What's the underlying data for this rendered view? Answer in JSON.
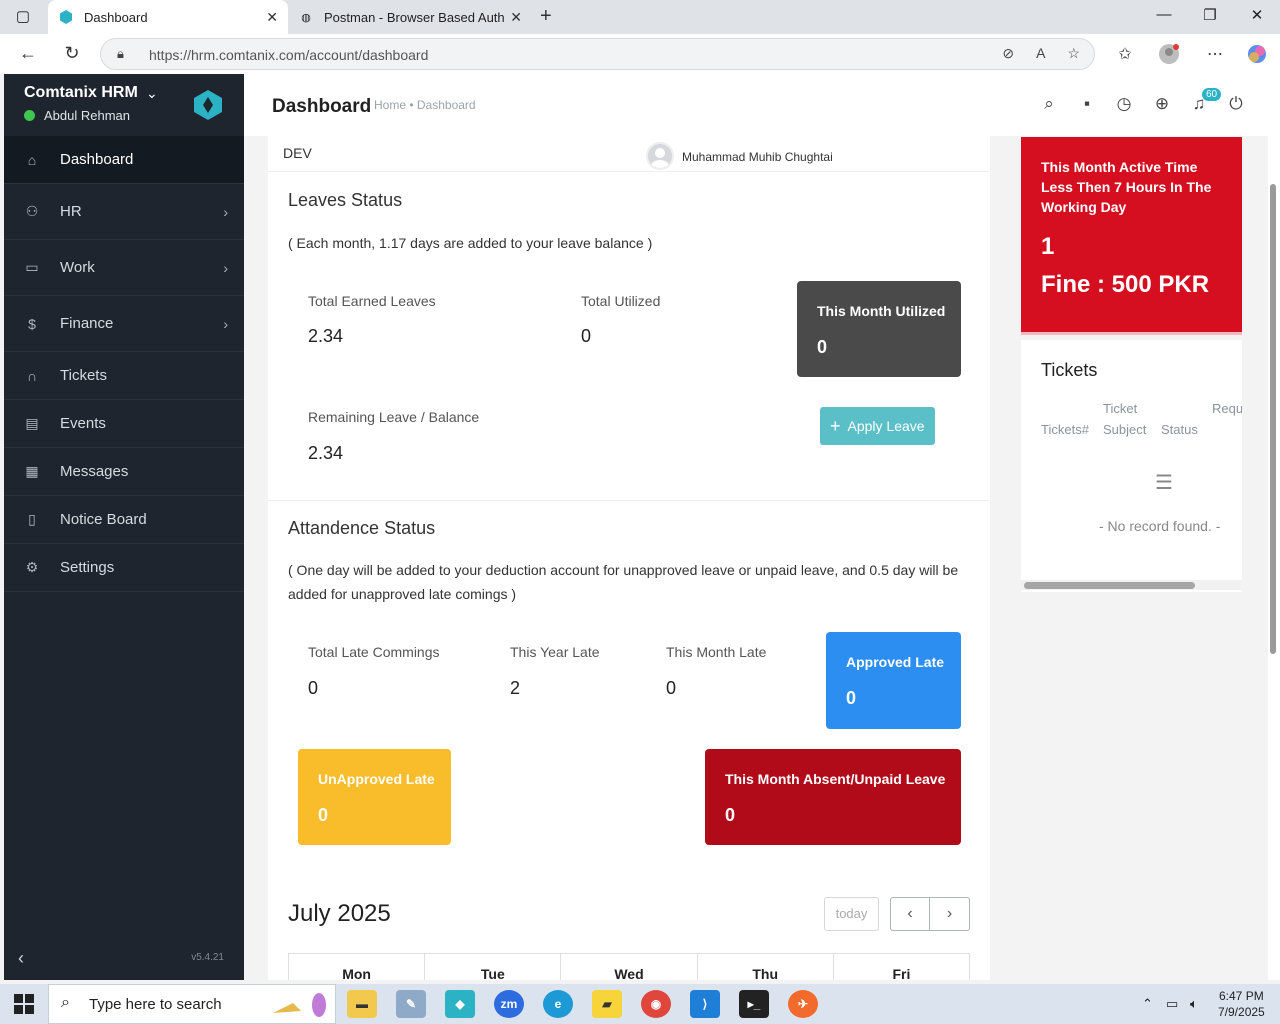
{
  "browser": {
    "tabs": [
      {
        "label": "Dashboard",
        "active": true
      },
      {
        "label": "Postman - Browser Based Auth",
        "active": false
      }
    ],
    "url": "https://hrm.comtanix.com/account/dashboard"
  },
  "sidebar": {
    "brand": "Comtanix HRM",
    "user": "Abdul Rehman",
    "version": "v5.4.21",
    "items": [
      {
        "label": "Dashboard",
        "icon": "home-icon"
      },
      {
        "label": "HR",
        "icon": "users-icon"
      },
      {
        "label": "Work",
        "icon": "briefcase-icon"
      },
      {
        "label": "Finance",
        "icon": "dollar-icon"
      },
      {
        "label": "Tickets",
        "icon": "headset-icon"
      },
      {
        "label": "Events",
        "icon": "calendar-icon"
      },
      {
        "label": "Messages",
        "icon": "message-icon"
      },
      {
        "label": "Notice Board",
        "icon": "clipboard-icon"
      },
      {
        "label": "Settings",
        "icon": "gear-icon"
      }
    ]
  },
  "header": {
    "title": "Dashboard",
    "breadcrumb": "Home • Dashboard",
    "notification_count": "60"
  },
  "main": {
    "dev_label": "DEV",
    "dev_user": "Muhammad Muhib Chughtai",
    "leaves": {
      "title": "Leaves Status",
      "note": "( Each month, 1.17 days are added to your leave balance )",
      "total_earned_label": "Total Earned Leaves",
      "total_earned_value": "2.34",
      "total_utilized_label": "Total Utilized",
      "total_utilized_value": "0",
      "month_utilized_label": "This Month Utilized",
      "month_utilized_value": "0",
      "remaining_label": "Remaining Leave / Balance",
      "remaining_value": "2.34",
      "apply_label": "Apply Leave"
    },
    "attendance": {
      "title": "Attandence Status",
      "note": "( One day will be added to your deduction account for unapproved leave or unpaid leave, and 0.5 day will be added for unapproved late comings )",
      "total_late_label": "Total Late Commings",
      "total_late_value": "0",
      "year_late_label": "This Year Late",
      "year_late_value": "2",
      "month_late_label": "This Month Late",
      "month_late_value": "0",
      "approved_late_label": "Approved Late",
      "approved_late_value": "0",
      "unapproved_late_label": "UnApproved Late",
      "unapproved_late_value": "0",
      "absent_label": "This Month Absent/Unpaid Leave",
      "absent_value": "0"
    },
    "calendar": {
      "month": "July 2025",
      "today_label": "today",
      "days": [
        "Mon",
        "Tue",
        "Wed",
        "Thu",
        "Fri"
      ]
    }
  },
  "fine": {
    "text": "This Month Active Time Less Then 7 Hours In The Working Day",
    "count": "1",
    "amount": "Fine : 500 PKR"
  },
  "tickets": {
    "title": "Tickets",
    "col_ticket_no": "Tickets#",
    "col_subject_top": "Ticket",
    "col_subject": "Subject",
    "col_status": "Status",
    "col_req": "Requ",
    "empty": "- No record found. -"
  },
  "taskbar": {
    "search_placeholder": "Type here to search",
    "time": "6:47 PM",
    "date": "7/9/2025"
  },
  "colors": {
    "sidebar_bg": "#1e252e",
    "fine_red": "#d50f1f",
    "approved_blue": "#2b8ef0",
    "unapproved_yellow": "#f9bd2c",
    "absent_red": "#b10a18",
    "utilized_grey": "#4a4a4a",
    "apply_teal": "#5bbfc8"
  }
}
